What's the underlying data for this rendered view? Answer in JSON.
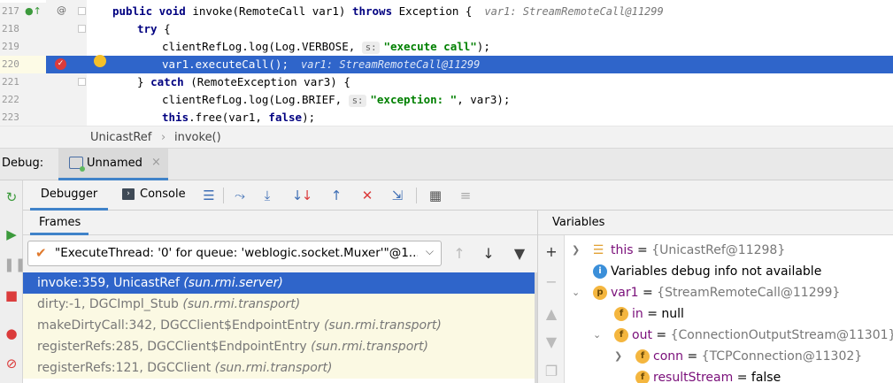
{
  "editor": {
    "lines": [
      {
        "num": "217",
        "indent": 0,
        "kind": "sig"
      },
      {
        "num": "218",
        "indent": 1,
        "kind": "try"
      },
      {
        "num": "219",
        "indent": 2,
        "kind": "log1"
      },
      {
        "num": "220",
        "indent": 2,
        "kind": "exec"
      },
      {
        "num": "221",
        "indent": 1,
        "kind": "catch"
      },
      {
        "num": "222",
        "indent": 2,
        "kind": "log2"
      },
      {
        "num": "223",
        "indent": 2,
        "kind": "free"
      }
    ],
    "sig": {
      "kw1": "public void",
      "text1": " invoke(RemoteCall var1) ",
      "kw2": "throws",
      "text2": " Exception {",
      "inline": "var1: StreamRemoteCall@11299"
    },
    "try_kw": "try",
    "try_rest": " {",
    "log1": {
      "pre": "clientRefLog.log(Log.VERBOSE, ",
      "hint": "s:",
      "str": "\"execute call\"",
      "post": ");"
    },
    "exec": {
      "code": "var1.executeCall();",
      "inline": "var1: StreamRemoteCall@11299"
    },
    "catch": {
      "pre": "} ",
      "kw": "catch",
      "post": " (RemoteException var3) {"
    },
    "log2": {
      "pre": "clientRefLog.log(Log.BRIEF, ",
      "hint": "s:",
      "str": "\"exception: \"",
      "post": ", var3);"
    },
    "free": {
      "kw": "this",
      "post": ".free(var1, ",
      "kw2": "false",
      "post2": ");"
    }
  },
  "breadcrumb": {
    "class_name": "UnicastRef",
    "sep": "›",
    "method": "invoke()"
  },
  "debug_window": {
    "label": "Debug:",
    "session_name": "Unnamed",
    "close": "×"
  },
  "tabs": {
    "debugger": "Debugger",
    "console": "Console"
  },
  "frames": {
    "title": "Frames",
    "thread": "\"ExecuteThread: '0' for queue: 'weblogic.socket.Muxer'\"@1...",
    "items": [
      {
        "method": "invoke:359, UnicastRef",
        "pkg": "(sun.rmi.server)",
        "selected": true
      },
      {
        "method": "dirty:-1, DGCImpl_Stub",
        "pkg": "(sun.rmi.transport)",
        "selected": false
      },
      {
        "method": "makeDirtyCall:342, DGCClient$EndpointEntry",
        "pkg": "(sun.rmi.transport)",
        "selected": false
      },
      {
        "method": "registerRefs:285, DGCClient$EndpointEntry",
        "pkg": "(sun.rmi.transport)",
        "selected": false
      },
      {
        "method": "registerRefs:121, DGCClient",
        "pkg": "(sun.rmi.transport)",
        "selected": false
      }
    ]
  },
  "variables": {
    "title": "Variables",
    "items": [
      {
        "name": "this",
        "eq": " = ",
        "value": "{UnicastRef@11298}"
      },
      {
        "info": "Variables debug info not available"
      },
      {
        "name": "var1",
        "eq": " = ",
        "value": "{StreamRemoteCall@11299}"
      },
      {
        "name": "in",
        "eq": " = ",
        "value": "null"
      },
      {
        "name": "out",
        "eq": " = ",
        "value": "{ConnectionOutputStream@11301}"
      },
      {
        "name": "conn",
        "eq": " = ",
        "value": "{TCPConnection@11302}"
      },
      {
        "name": "resultStream",
        "eq": " = ",
        "value": "false"
      }
    ]
  },
  "icons": {
    "colors": {
      "accent": "#4083c9",
      "selection": "#2f65ca",
      "breakpoint": "#db3b3b",
      "resume": "#3c9a3c"
    }
  }
}
